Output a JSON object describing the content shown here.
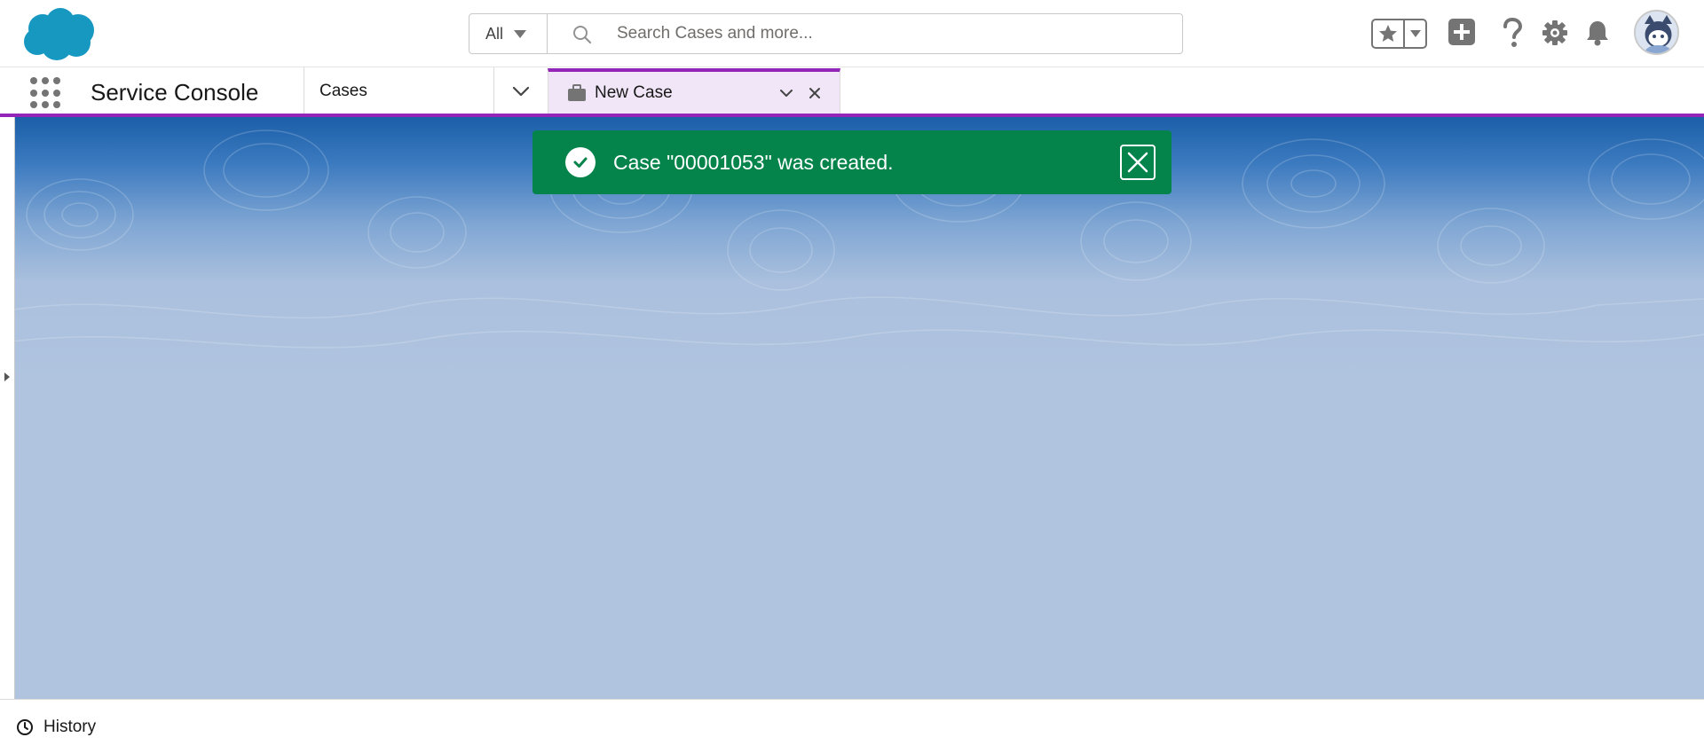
{
  "header": {
    "search_scope": "All",
    "search_placeholder": "Search Cases and more...",
    "icons": [
      "salesforce-logo",
      "favorites-star-icon",
      "favorites-dropdown-icon",
      "global-actions-add-icon",
      "help-icon",
      "setup-gear-icon",
      "notifications-bell-icon",
      "user-avatar"
    ]
  },
  "nav": {
    "app_name": "Service Console",
    "nav_item": "Cases",
    "active_tab": "New Case"
  },
  "toast": {
    "message": "Case \"00001053\" was created.",
    "variant": "success",
    "color": "#04844b"
  },
  "utility_bar": {
    "history_label": "History"
  },
  "colors": {
    "accent": "#9326b8",
    "brand_blue": "#1798c1",
    "workspace_bg": "#b0c4df",
    "success": "#04844b"
  }
}
